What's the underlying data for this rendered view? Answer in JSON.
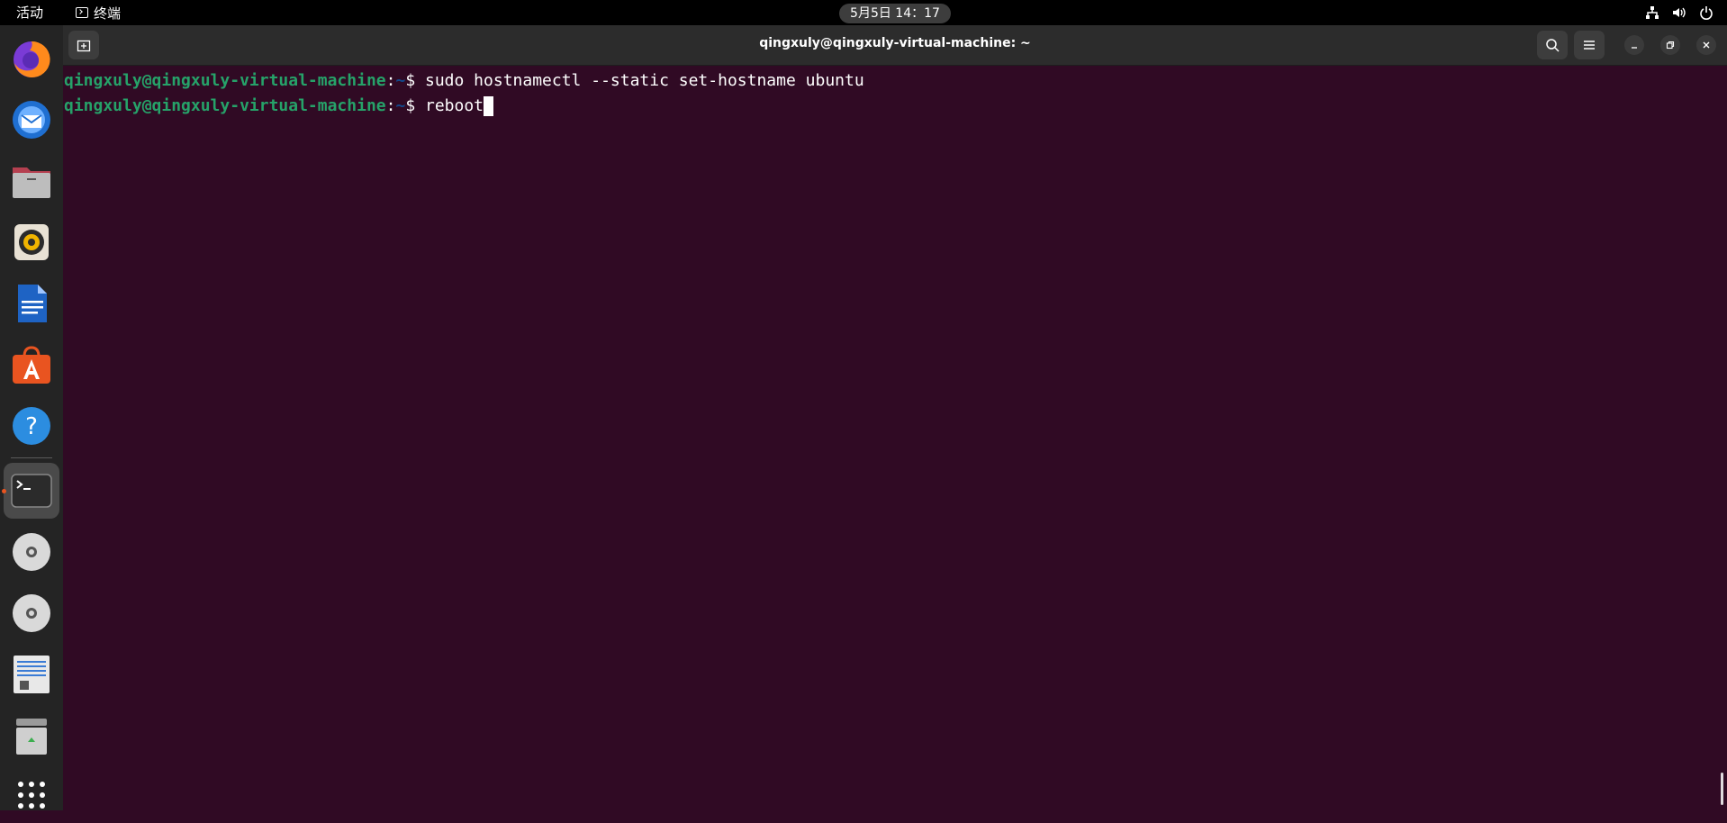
{
  "top_bar": {
    "activities": "活动",
    "app_name": "终端",
    "clock": "5月5日 14：17",
    "tray_icons": [
      "network-icon",
      "volume-icon",
      "power-icon"
    ]
  },
  "dock": {
    "items": [
      {
        "name": "firefox",
        "active": false
      },
      {
        "name": "thunderbird",
        "active": false
      },
      {
        "name": "files",
        "active": false
      },
      {
        "name": "rhythmbox",
        "active": false
      },
      {
        "name": "libreoffice-writer",
        "active": false
      },
      {
        "name": "app-center",
        "active": false
      },
      {
        "name": "help",
        "active": false
      },
      {
        "name": "terminal",
        "active": true
      },
      {
        "name": "optical-drive",
        "active": false
      },
      {
        "name": "optical-drive",
        "active": false
      },
      {
        "name": "text-file",
        "active": false
      },
      {
        "name": "trash",
        "active": false
      },
      {
        "name": "show-apps",
        "active": false
      }
    ]
  },
  "terminal": {
    "title": "qingxuly@qingxuly-virtual-machine: ~",
    "lines": [
      {
        "user_host": "qingxuly@qingxuly-virtual-machine",
        "sep": ":",
        "path": "~",
        "prompt": "$ ",
        "command": "sudo hostnamectl --static set-hostname ubuntu"
      },
      {
        "user_host": "qingxuly@qingxuly-virtual-machine",
        "sep": ":",
        "path": "~",
        "prompt": "$ ",
        "command": "reboot"
      }
    ]
  },
  "colors": {
    "background": "#300a24",
    "user_host": "#26a269",
    "path": "#12488b",
    "accent": "#e95420"
  }
}
